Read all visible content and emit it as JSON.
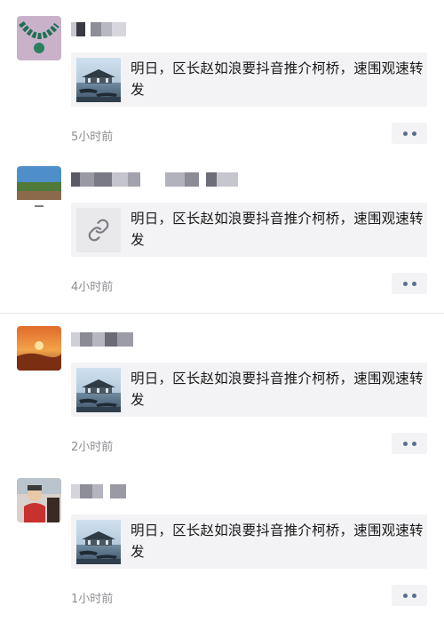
{
  "share_text": "明日，区长赵如浪要抖音推介柯桥，速围观速转发",
  "posts": [
    {
      "time": "5小时前",
      "attachment": "image-thumbnail",
      "more_icon": "more-dots-icon"
    },
    {
      "time": "4小时前",
      "attachment": "link-icon",
      "more_icon": "more-dots-icon"
    },
    {
      "time": "2小时前",
      "attachment": "image-thumbnail",
      "more_icon": "more-dots-icon"
    },
    {
      "time": "1小时前",
      "attachment": "image-thumbnail",
      "more_icon": "more-dots-icon"
    }
  ],
  "colors": {
    "card_bg": "#f3f3f5",
    "time_text": "#8e8e93",
    "dots": "#5b6e8f"
  }
}
